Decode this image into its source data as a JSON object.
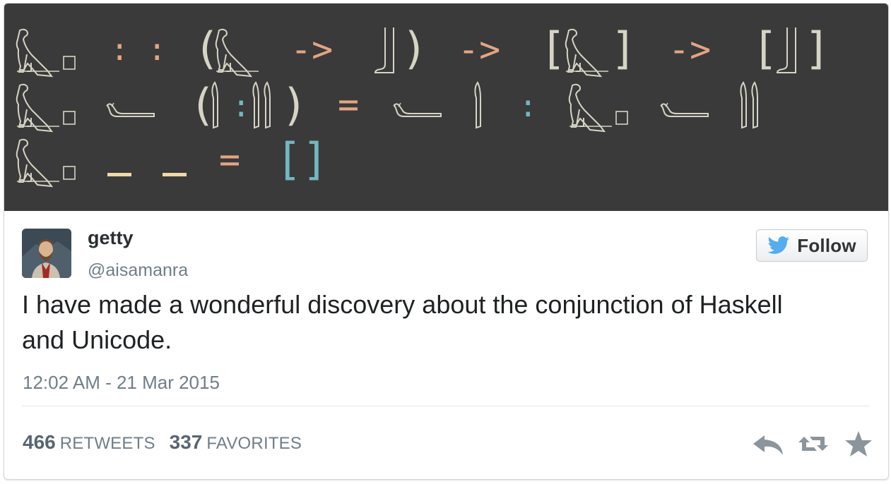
{
  "code_image": {
    "colors": {
      "background": "#3a3a3a",
      "glyph": "#d6d4c4",
      "operator": "#e3a582",
      "colon": "#74b7c1",
      "underscore": "#efd9a4",
      "list_literal": "#74b7c1"
    },
    "lines": [
      [
        "vulture-glyph",
        "::",
        "(",
        "vulture-glyph",
        "->",
        "leg-glyph",
        ")",
        "->",
        "[",
        "vulture-glyph",
        "]",
        "->",
        "[",
        "leg-glyph",
        "]"
      ],
      [
        "vulture-glyph",
        "reclining-figure-glyph",
        "(",
        "reed-glyph",
        ":",
        "double-reed-glyph",
        ")",
        "=",
        "reclining-figure-glyph",
        "reed-glyph",
        ":",
        "vulture-glyph",
        "reclining-figure-glyph",
        "double-reed-glyph"
      ],
      [
        "vulture-glyph",
        "_",
        "_",
        "=",
        "[]"
      ]
    ]
  },
  "user": {
    "display_name": "getty",
    "handle": "@aisamanra",
    "avatar_icon": "user-avatar"
  },
  "follow_button": {
    "label": "Follow",
    "icon": "twitter-bird-icon",
    "color": "#55acee"
  },
  "tweet": {
    "text": "I have made a wonderful discovery about the conjunction of Haskell and Unicode.",
    "timestamp": "12:02 AM - 21 Mar 2015"
  },
  "stats": {
    "retweets_count": "466",
    "retweets_label": "RETWEETS",
    "favorites_count": "337",
    "favorites_label": "FAVORITES"
  },
  "actions": [
    {
      "name": "reply",
      "icon": "reply-icon"
    },
    {
      "name": "retweet",
      "icon": "retweet-icon"
    },
    {
      "name": "favorite",
      "icon": "star-icon"
    }
  ]
}
